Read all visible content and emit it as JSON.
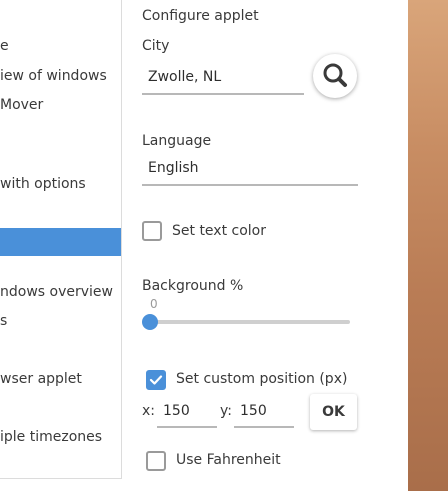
{
  "sidebar": {
    "items": [
      {
        "label": "e"
      },
      {
        "label": "iew of windows"
      },
      {
        "label": "Mover"
      },
      {
        "label": "with options"
      },
      {
        "label": ""
      },
      {
        "label": "ndows overview"
      },
      {
        "label": "s"
      },
      {
        "label": "wser applet"
      },
      {
        "label": "iple timezones"
      }
    ]
  },
  "config": {
    "title": "Configure applet",
    "city_label": "City",
    "city_value": "Zwolle, NL",
    "language_label": "Language",
    "language_value": "English",
    "set_text_color_label": "Set text color",
    "set_text_color_checked": false,
    "background_label": "Background %",
    "background_value": "0",
    "custom_position_label": "Set custom position (px)",
    "custom_position_checked": true,
    "x_label": "x:",
    "x_value": "150",
    "y_label": "y:",
    "y_value": "150",
    "ok_label": "OK",
    "fahrenheit_label": "Use Fahrenheit",
    "fahrenheit_checked": false
  },
  "colors": {
    "accent": "#4a90d9"
  },
  "icons": {
    "search": "search-icon",
    "check": "check-icon"
  }
}
